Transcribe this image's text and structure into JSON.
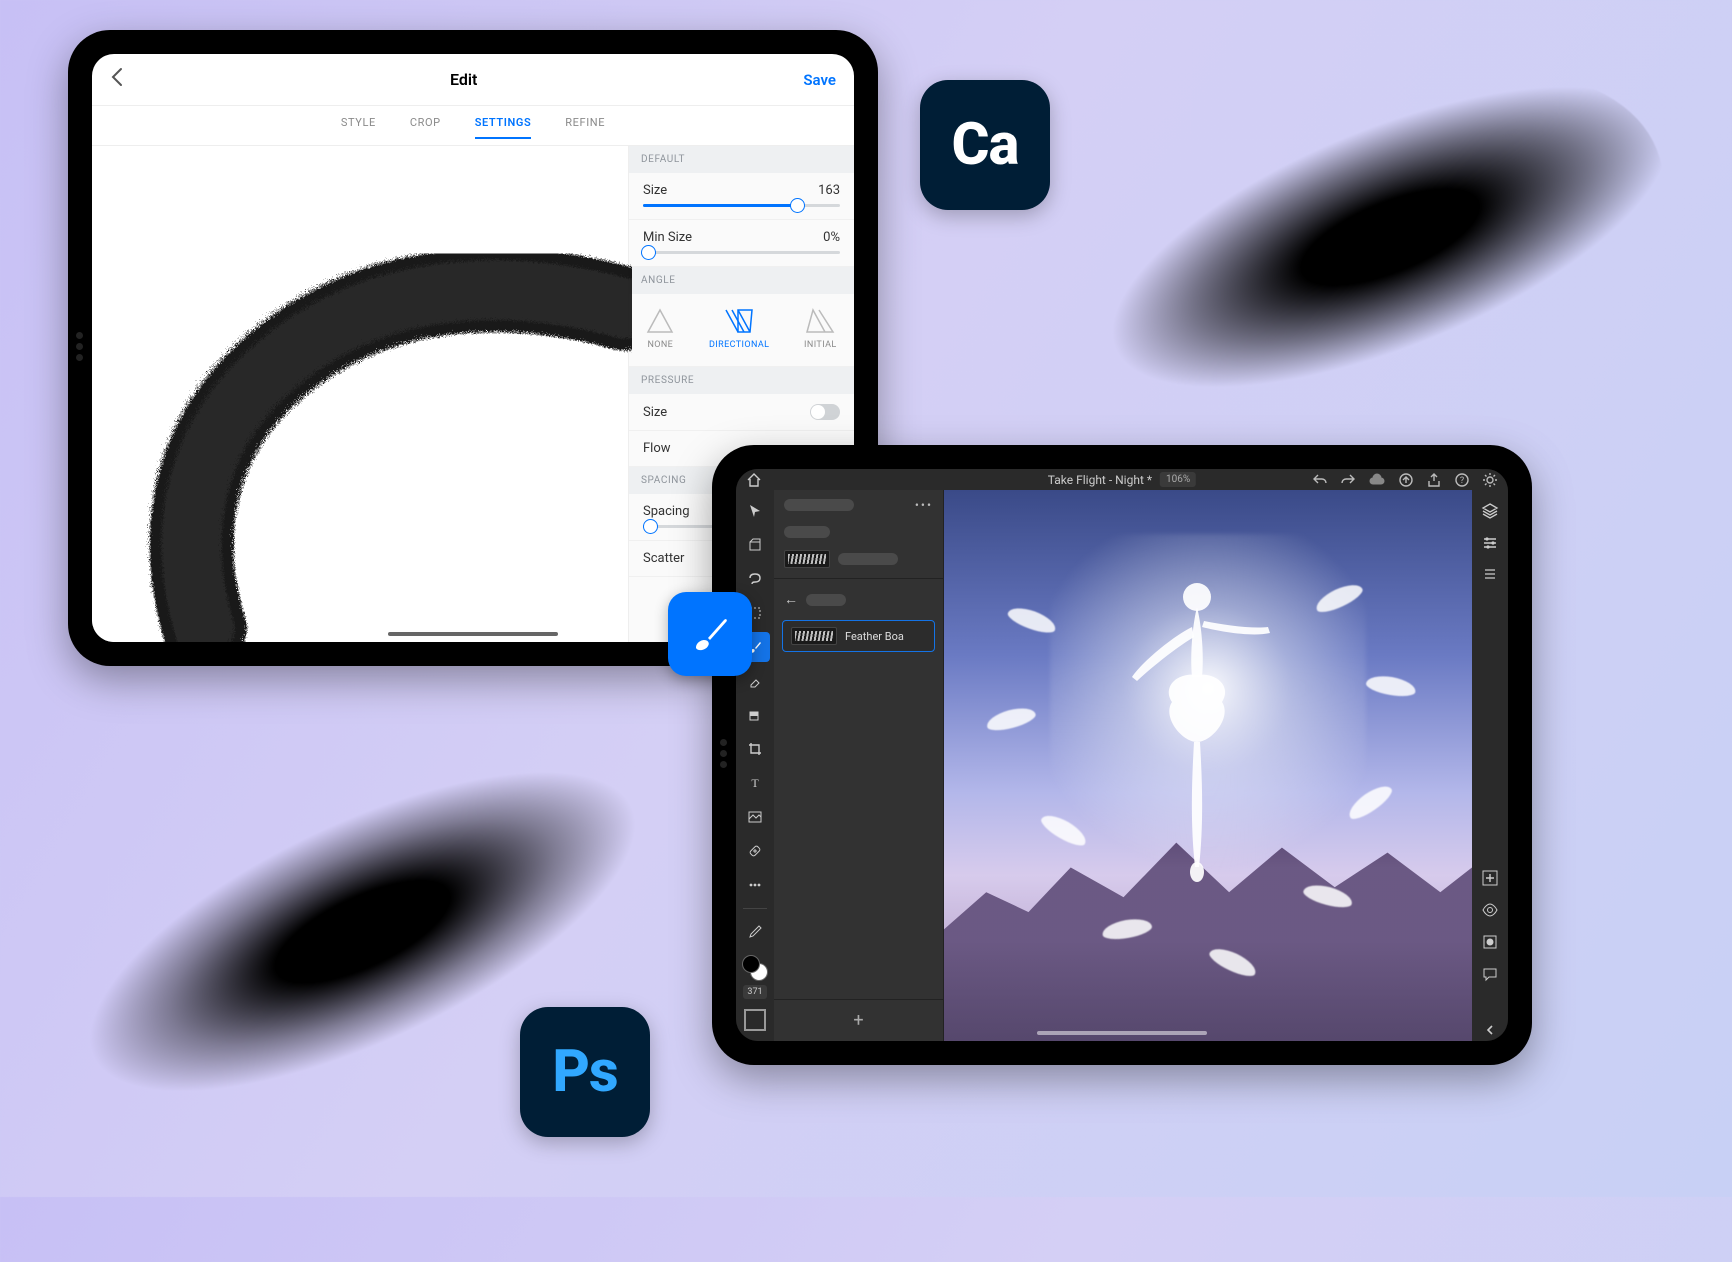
{
  "badges": {
    "capture": "Ca",
    "photoshop": "Ps"
  },
  "capture": {
    "title": "Edit",
    "save": "Save",
    "tabs": [
      "STYLE",
      "CROP",
      "SETTINGS",
      "REFINE"
    ],
    "active_tab": 2,
    "groups": {
      "default": "DEFAULT",
      "angle": "ANGLE",
      "pressure": "PRESSURE",
      "spacing": "SPACING"
    },
    "settings": {
      "size": {
        "label": "Size",
        "value": "163",
        "pct": 78
      },
      "min_size": {
        "label": "Min Size",
        "value": "0%",
        "pct": 0
      },
      "angle_options": [
        "NONE",
        "DIRECTIONAL",
        "INITIAL"
      ],
      "angle_selected": 1,
      "pressure": {
        "size": {
          "label": "Size",
          "on": false
        },
        "flow": {
          "label": "Flow"
        }
      },
      "spacing": {
        "label": "Spacing",
        "pct": 3
      },
      "scatter": {
        "label": "Scatter"
      }
    }
  },
  "photoshop": {
    "doc_title": "Take Flight - Night *",
    "zoom": "106%",
    "brush_panel": {
      "selected_name": "Feather Boa",
      "add": "+"
    },
    "tool_badge": "371"
  }
}
